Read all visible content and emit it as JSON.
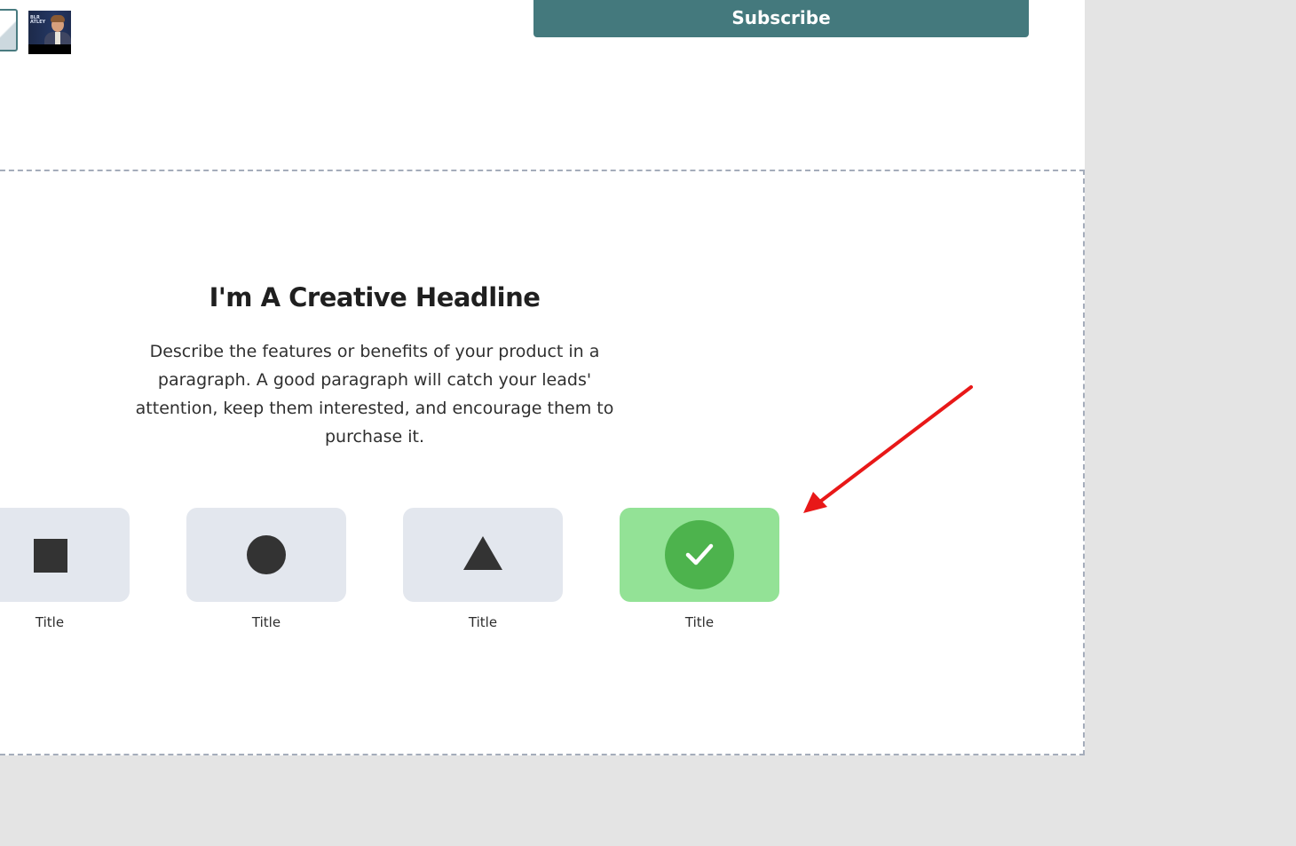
{
  "header": {
    "subscribe_label": "Subscribe"
  },
  "thumbnails": {
    "video_thumb_text": "BLR\nATLEY"
  },
  "section": {
    "headline": "I'm A Creative Headline",
    "paragraph": "Describe the features or benefits of your product in a paragraph. A good paragraph will catch your leads' attention, keep them interested, and encourage them to purchase it."
  },
  "features": [
    {
      "label": "Title",
      "icon": "square-icon"
    },
    {
      "label": "Title",
      "icon": "circle-icon"
    },
    {
      "label": "Title",
      "icon": "triangle-icon"
    },
    {
      "label": "Title",
      "icon": "check-circle-icon"
    }
  ],
  "colors": {
    "accent": "#44797d",
    "selected_card": "#93e296",
    "check_circle": "#4db34d",
    "card_bg": "#e3e7ee",
    "annotation_arrow": "#e81818",
    "canvas_bg": "#e4e4e4"
  },
  "annotation": {
    "icon": "red-arrow-icon"
  }
}
